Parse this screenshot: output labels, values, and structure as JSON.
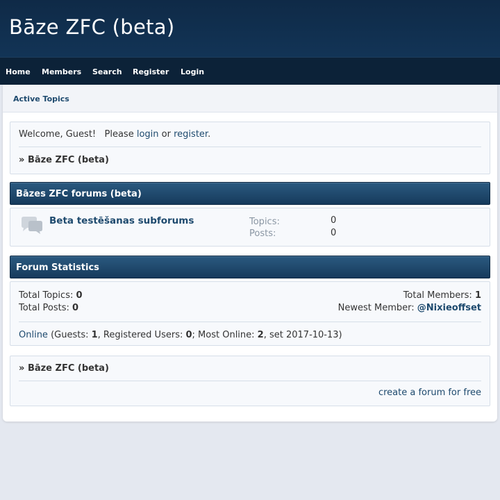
{
  "header": {
    "site_title": "Bāze ZFC (beta)"
  },
  "nav": {
    "items": [
      {
        "label": "Home"
      },
      {
        "label": "Members"
      },
      {
        "label": "Search"
      },
      {
        "label": "Register"
      },
      {
        "label": "Login"
      }
    ]
  },
  "subnav": {
    "active_topics": "Active Topics"
  },
  "welcome": {
    "prefix": "Welcome, Guest!   Please",
    "login_link": "login",
    "or_text": "or",
    "register_link": "register",
    "period": ".",
    "breadcrumb_marker": "»",
    "breadcrumb_label": "Bāze ZFC (beta)"
  },
  "category": {
    "title": "Bāzes ZFC forums (beta)",
    "forums": [
      {
        "name": "Beta testēšanas subforums",
        "topics_label": "Topics:",
        "topics_value": "0",
        "posts_label": "Posts:",
        "posts_value": "0"
      }
    ]
  },
  "stats": {
    "title": "Forum Statistics",
    "total_topics_label": "Total Topics:",
    "total_topics_value": "0",
    "total_posts_label": "Total Posts:",
    "total_posts_value": "0",
    "total_members_label": "Total Members:",
    "total_members_value": "1",
    "newest_member_label": "Newest Member:",
    "newest_member_value": "@Nixieoffset",
    "online_link": "Online",
    "guests_label": "(Guests:",
    "guests_value": "1",
    "registered_label": ", Registered Users:",
    "registered_value": "0",
    "most_online_label": "; Most Online:",
    "most_online_value": "2",
    "most_online_date": ", set 2017-10-13)"
  },
  "footer": {
    "breadcrumb_marker": "»",
    "breadcrumb_label": "Bāze ZFC (beta)",
    "create_forum_link": "create a forum for free"
  },
  "icons": {
    "forum": "speech-bubbles-icon"
  }
}
